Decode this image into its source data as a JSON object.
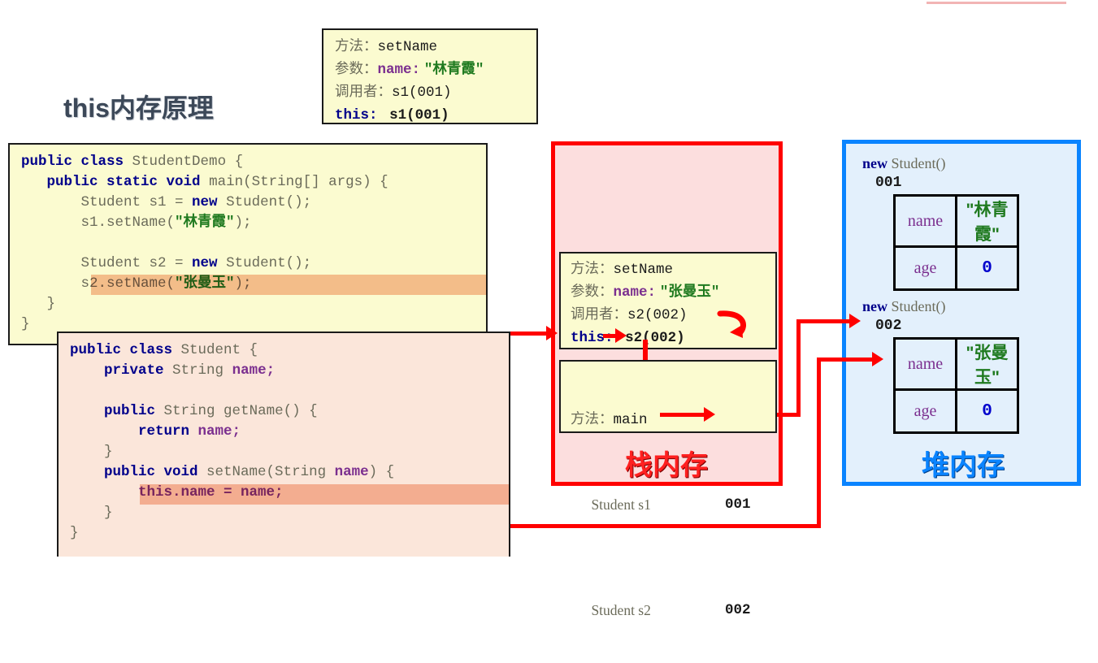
{
  "title": "this内存原理",
  "top_rule_color": "#f2b4b4",
  "code_demo": {
    "name": "StudentDemo.java",
    "lines": [
      "public class StudentDemo {",
      "   public static void main(String[] args) {",
      "       Student s1 = new Student();",
      "       s1.setName(\"林青霞\");",
      "",
      "       Student s2 = new Student();",
      "       s2.setName(\"张曼玉\");",
      "   }",
      "}"
    ],
    "highlighted_line": "s2.setName(\"张曼玉\");"
  },
  "code_student": {
    "name": "Student.java",
    "lines": [
      "public class Student {",
      "    private String name;",
      "",
      "    public String getName() {",
      "        return name;",
      "    }",
      "    public void setName(String name) {",
      "        this.name = name;",
      "    }",
      "}"
    ],
    "highlighted_line": "this.name = name;"
  },
  "frame_setname_top": {
    "method_label": "方法：",
    "method_value": "setName",
    "param_label": "参数：",
    "param_name": "name:",
    "param_value": "\"林青霞\"",
    "caller_label": "调用者：",
    "caller_value": "s1(001)",
    "this_label": "this:",
    "this_value": "s1(001)"
  },
  "frame_setname_stack": {
    "method_label": "方法：",
    "method_value": "setName",
    "param_label": "参数：",
    "param_name": "name:",
    "param_value": "\"张曼玉\"",
    "caller_label": "调用者：",
    "caller_value": "s2(002)",
    "this_label": "this:",
    "this_value": "s2(002)"
  },
  "frame_main": {
    "method_label": "方法：",
    "method_value": "main",
    "vars": [
      {
        "decl": "Student s1",
        "addr": "001"
      },
      {
        "decl": "Student s2",
        "addr": "002"
      }
    ]
  },
  "stack": {
    "label": "栈内存",
    "border_color": "#ff0000",
    "fill_color": "#fcdede"
  },
  "heap": {
    "label": "堆内存",
    "border_color": "#0a84ff",
    "fill_color": "#e3f0fc",
    "objects": [
      {
        "header_kw": "new",
        "header_type": "Student()",
        "address": "001",
        "rows": [
          {
            "field": "name",
            "value": "\"林青霞\"",
            "kind": "string"
          },
          {
            "field": "age",
            "value": "0",
            "kind": "number"
          }
        ]
      },
      {
        "header_kw": "new",
        "header_type": "Student()",
        "address": "002",
        "rows": [
          {
            "field": "name",
            "value": "\"张曼玉\"",
            "kind": "string"
          },
          {
            "field": "age",
            "value": "0",
            "kind": "number"
          }
        ]
      }
    ]
  },
  "colors": {
    "keyword": "#00008b",
    "string": "#1f7a1f",
    "field": "#7b2f8f",
    "code_text": "#6b6b5a",
    "highlight": "#f7c0a8",
    "yellow_bg": "#fbfbd0",
    "peach_bg": "#fbe6da",
    "arrow": "#ff0000"
  }
}
